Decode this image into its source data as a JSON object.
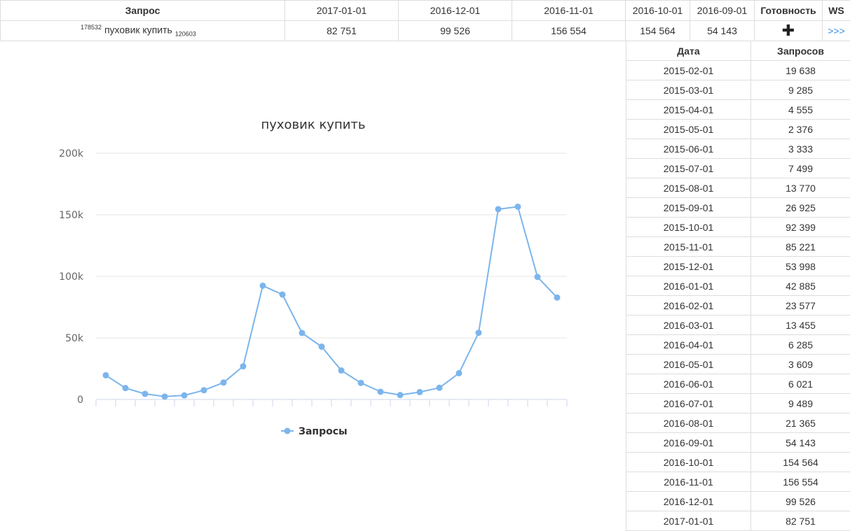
{
  "header": {
    "columns": [
      "Запрос",
      "2017-01-01",
      "2016-12-01",
      "2016-11-01",
      "2016-10-01",
      "2016-09-01",
      "Готовность",
      "WS"
    ],
    "row": {
      "query_prefix": "178532",
      "query": "пуховик купить",
      "query_suffix": "120603",
      "values": [
        "82 751",
        "99 526",
        "156 554",
        "154 564",
        "54 143"
      ],
      "ready_icon": "plus-icon",
      "ready_symbol": "✚",
      "ws_link": ">>>"
    }
  },
  "side_table": {
    "headers": [
      "Дата",
      "Запросов"
    ],
    "rows": [
      [
        "2015-02-01",
        "19 638"
      ],
      [
        "2015-03-01",
        "9 285"
      ],
      [
        "2015-04-01",
        "4 555"
      ],
      [
        "2015-05-01",
        "2 376"
      ],
      [
        "2015-06-01",
        "3 333"
      ],
      [
        "2015-07-01",
        "7 499"
      ],
      [
        "2015-08-01",
        "13 770"
      ],
      [
        "2015-09-01",
        "26 925"
      ],
      [
        "2015-10-01",
        "92 399"
      ],
      [
        "2015-11-01",
        "85 221"
      ],
      [
        "2015-12-01",
        "53 998"
      ],
      [
        "2016-01-01",
        "42 885"
      ],
      [
        "2016-02-01",
        "23 577"
      ],
      [
        "2016-03-01",
        "13 455"
      ],
      [
        "2016-04-01",
        "6 285"
      ],
      [
        "2016-05-01",
        "3 609"
      ],
      [
        "2016-06-01",
        "6 021"
      ],
      [
        "2016-07-01",
        "9 489"
      ],
      [
        "2016-08-01",
        "21 365"
      ],
      [
        "2016-09-01",
        "54 143"
      ],
      [
        "2016-10-01",
        "154 564"
      ],
      [
        "2016-11-01",
        "156 554"
      ],
      [
        "2016-12-01",
        "99 526"
      ],
      [
        "2017-01-01",
        "82 751"
      ]
    ]
  },
  "colors": {
    "series": "#7cb5ec",
    "grid": "#e6e6e6",
    "axis": "#ccd6eb",
    "border": "#dddddd",
    "link": "#3a8ee6"
  },
  "chart_data": {
    "type": "line",
    "title": "пуховик купить",
    "xlabel": "",
    "ylabel": "",
    "x": [
      "2015-02-01",
      "2015-03-01",
      "2015-04-01",
      "2015-05-01",
      "2015-06-01",
      "2015-07-01",
      "2015-08-01",
      "2015-09-01",
      "2015-10-01",
      "2015-11-01",
      "2015-12-01",
      "2016-01-01",
      "2016-02-01",
      "2016-03-01",
      "2016-04-01",
      "2016-05-01",
      "2016-06-01",
      "2016-07-01",
      "2016-08-01",
      "2016-09-01",
      "2016-10-01",
      "2016-11-01",
      "2016-12-01",
      "2017-01-01"
    ],
    "series": [
      {
        "name": "Запросы",
        "values": [
          19638,
          9285,
          4555,
          2376,
          3333,
          7499,
          13770,
          26925,
          92399,
          85221,
          53998,
          42885,
          23577,
          13455,
          6285,
          3609,
          6021,
          9489,
          21365,
          54143,
          154564,
          156554,
          99526,
          82751
        ]
      }
    ],
    "ylim": [
      0,
      200000
    ],
    "y_ticks": [
      0,
      50000,
      100000,
      150000,
      200000
    ],
    "y_tick_labels": [
      "0",
      "50k",
      "100k",
      "150k",
      "200k"
    ],
    "grid": true,
    "legend": "bottom-center"
  }
}
